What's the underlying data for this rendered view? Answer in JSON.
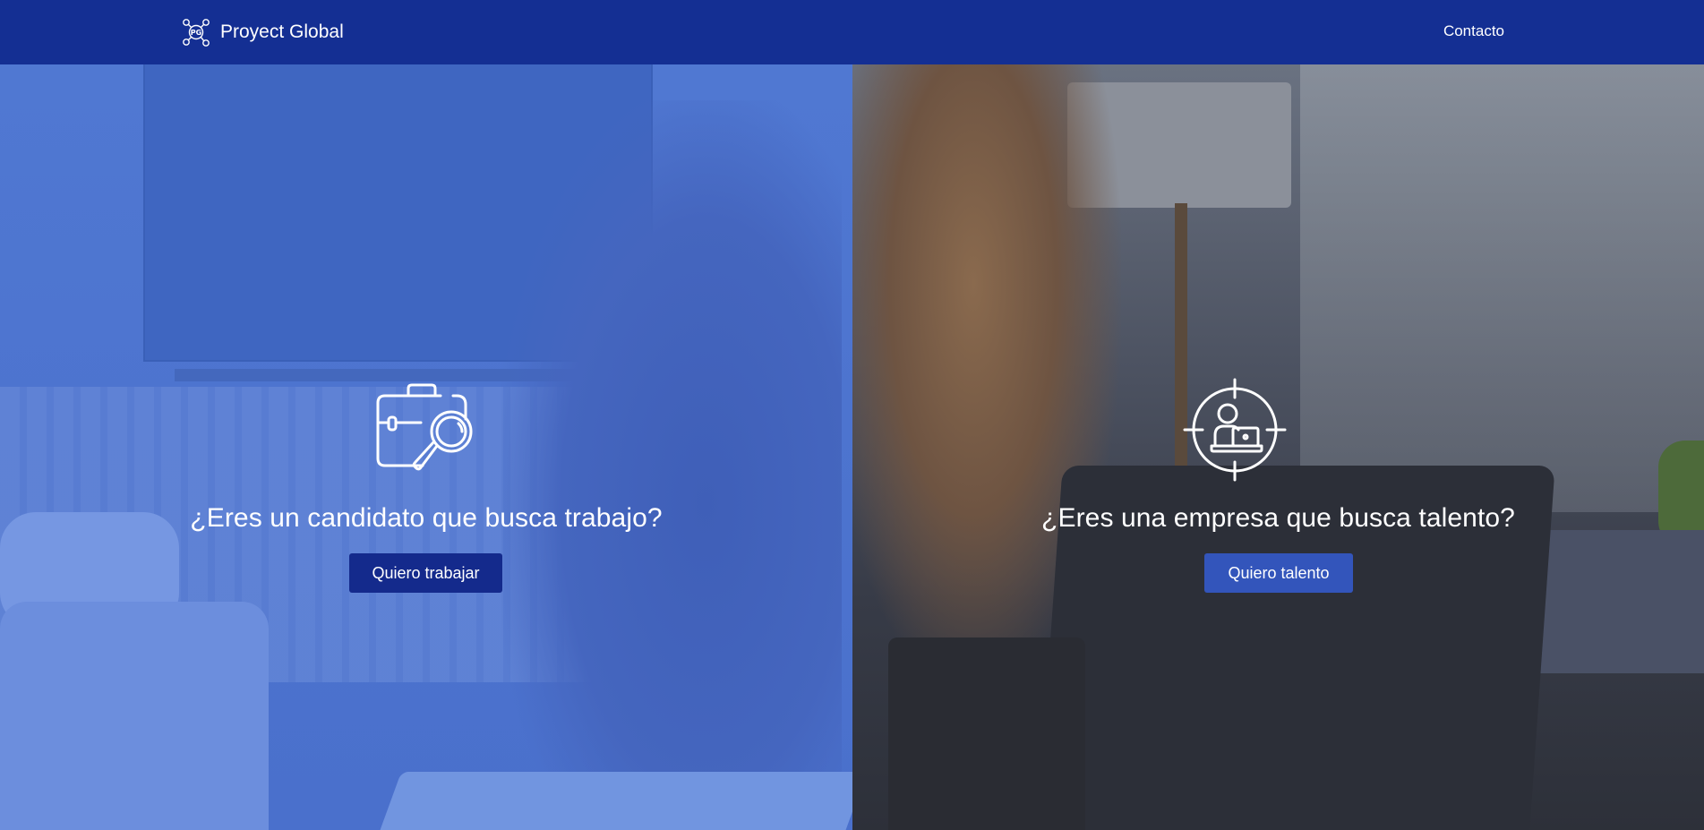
{
  "navbar": {
    "brand": "Proyect Global",
    "logo_initials": "PG",
    "link_contact": "Contacto"
  },
  "left_panel": {
    "heading": "¿Eres un candidato que busca trabajo?",
    "button": "Quiero trabajar",
    "icon": "briefcase-search-icon"
  },
  "right_panel": {
    "heading": "¿Eres una empresa que busca talento?",
    "button": "Quiero talento",
    "icon": "target-person-laptop-icon"
  },
  "colors": {
    "navbar_bg": "#142f93",
    "left_overlay": "#4a70cc",
    "left_button": "#142a8c",
    "right_button": "#3355bb",
    "text": "#ffffff"
  }
}
